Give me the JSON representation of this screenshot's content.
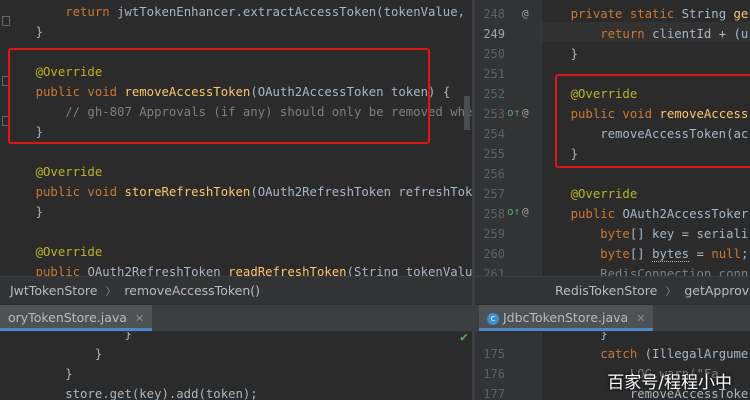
{
  "left_top": {
    "lines": [
      {
        "tokens": [
          {
            "c": "k",
            "t": "        return "
          },
          {
            "c": "t",
            "t": "jwtTokenEnhancer.extractAccessToken(tokenValue, "
          },
          {
            "c": "k",
            "t": "jwt"
          }
        ]
      },
      {
        "tokens": [
          {
            "c": "t",
            "t": "    }"
          }
        ]
      },
      {
        "tokens": []
      },
      {
        "tokens": [
          {
            "c": "a",
            "t": "    @Override"
          }
        ]
      },
      {
        "tokens": [
          {
            "c": "k",
            "t": "    public void "
          },
          {
            "c": "f",
            "t": "removeAccessToken"
          },
          {
            "c": "t",
            "t": "(OAuth2AccessToken token) {"
          }
        ]
      },
      {
        "tokens": [
          {
            "c": "c",
            "t": "        // gh-807 Approvals (if any) should only be removed when f"
          }
        ]
      },
      {
        "tokens": [
          {
            "c": "t",
            "t": "    }"
          }
        ]
      },
      {
        "tokens": []
      },
      {
        "tokens": [
          {
            "c": "a",
            "t": "    @Override"
          }
        ]
      },
      {
        "tokens": [
          {
            "c": "k",
            "t": "    public void "
          },
          {
            "c": "f",
            "t": "storeRefreshToken"
          },
          {
            "c": "t",
            "t": "(OAuth2RefreshToken refreshToken,"
          }
        ]
      },
      {
        "tokens": [
          {
            "c": "t",
            "t": "    }"
          }
        ]
      },
      {
        "tokens": []
      },
      {
        "tokens": [
          {
            "c": "a",
            "t": "    @Override"
          }
        ]
      },
      {
        "tokens": [
          {
            "c": "k",
            "t": "    public "
          },
          {
            "c": "t",
            "t": "OAuth2RefreshToken "
          },
          {
            "c": "f",
            "t": "readRefreshToken"
          },
          {
            "c": "t",
            "t": "(String tokenValue) {"
          }
        ]
      }
    ]
  },
  "right_top": {
    "line_numbers": [
      "248",
      "249",
      "250",
      "251",
      "252",
      "253",
      "254",
      "255",
      "256",
      "257",
      "258",
      "259",
      "260",
      "261"
    ],
    "current_line": "249",
    "lines": [
      {
        "tokens": [
          {
            "c": "k",
            "t": "    private static "
          },
          {
            "c": "t",
            "t": "String "
          },
          {
            "c": "f",
            "t": "ge"
          }
        ]
      },
      {
        "tokens": [
          {
            "c": "k",
            "t": "        return "
          },
          {
            "c": "t",
            "t": "clientId + (u"
          }
        ]
      },
      {
        "tokens": [
          {
            "c": "t",
            "t": "    }"
          }
        ]
      },
      {
        "tokens": []
      },
      {
        "tokens": [
          {
            "c": "a",
            "t": "    @Override"
          }
        ]
      },
      {
        "tokens": [
          {
            "c": "k",
            "t": "    public void "
          },
          {
            "c": "f",
            "t": "removeAccess"
          }
        ]
      },
      {
        "tokens": [
          {
            "c": "t",
            "t": "        removeAccessToken(ac"
          }
        ]
      },
      {
        "tokens": [
          {
            "c": "t",
            "t": "    }"
          }
        ]
      },
      {
        "tokens": []
      },
      {
        "tokens": [
          {
            "c": "a",
            "t": "    @Override"
          }
        ]
      },
      {
        "tokens": [
          {
            "c": "k",
            "t": "    public "
          },
          {
            "c": "t",
            "t": "OAuth2AccessToker"
          }
        ]
      },
      {
        "tokens": [
          {
            "c": "k",
            "t": "        byte"
          },
          {
            "c": "t",
            "t": "[] key = seriali"
          }
        ]
      },
      {
        "tokens": [
          {
            "c": "k",
            "t": "        byte"
          },
          {
            "c": "t",
            "t": "[] "
          },
          {
            "c": "under",
            "t": "bytes"
          },
          {
            "c": "t",
            "t": " = "
          },
          {
            "c": "k",
            "t": "null"
          },
          {
            "c": "t",
            "t": ";"
          }
        ]
      },
      {
        "tokens": [
          {
            "c": "c",
            "t": "        RedisConnection conn"
          }
        ]
      }
    ]
  },
  "breadcrumbs": {
    "left": [
      "JwtTokenStore",
      "removeAccessToken()"
    ],
    "right": [
      "RedisTokenStore",
      "getApprova"
    ]
  },
  "tabs": {
    "left": "oryTokenStore.java",
    "right": "JdbcTokenStore.java"
  },
  "left_bottom": {
    "lines": [
      {
        "tokens": [
          {
            "c": "t",
            "t": "                }"
          }
        ]
      },
      {
        "tokens": [
          {
            "c": "t",
            "t": "            }"
          }
        ]
      },
      {
        "tokens": [
          {
            "c": "t",
            "t": "        }"
          }
        ]
      },
      {
        "tokens": [
          {
            "c": "t",
            "t": "        store.get(key).add(token);"
          }
        ]
      }
    ]
  },
  "right_bottom": {
    "line_numbers": [
      "",
      "175",
      "176",
      "177"
    ],
    "lines": [
      {
        "tokens": [
          {
            "c": "t",
            "t": "        }"
          }
        ]
      },
      {
        "tokens": [
          {
            "c": "k",
            "t": "        catch "
          },
          {
            "c": "t",
            "t": "(IllegalArgume"
          }
        ]
      },
      {
        "tokens": [
          {
            "c": "c",
            "t": "            LOG.warn(\"Fa"
          }
        ]
      },
      {
        "tokens": [
          {
            "c": "t",
            "t": "            removeAccessToke"
          }
        ]
      }
    ]
  },
  "watermark": "百家号/程程小中",
  "colors": {
    "highlight": "#e01515",
    "background": "#2b2b2b",
    "gutter": "#313335",
    "tab_underline": "#4a88c7"
  }
}
